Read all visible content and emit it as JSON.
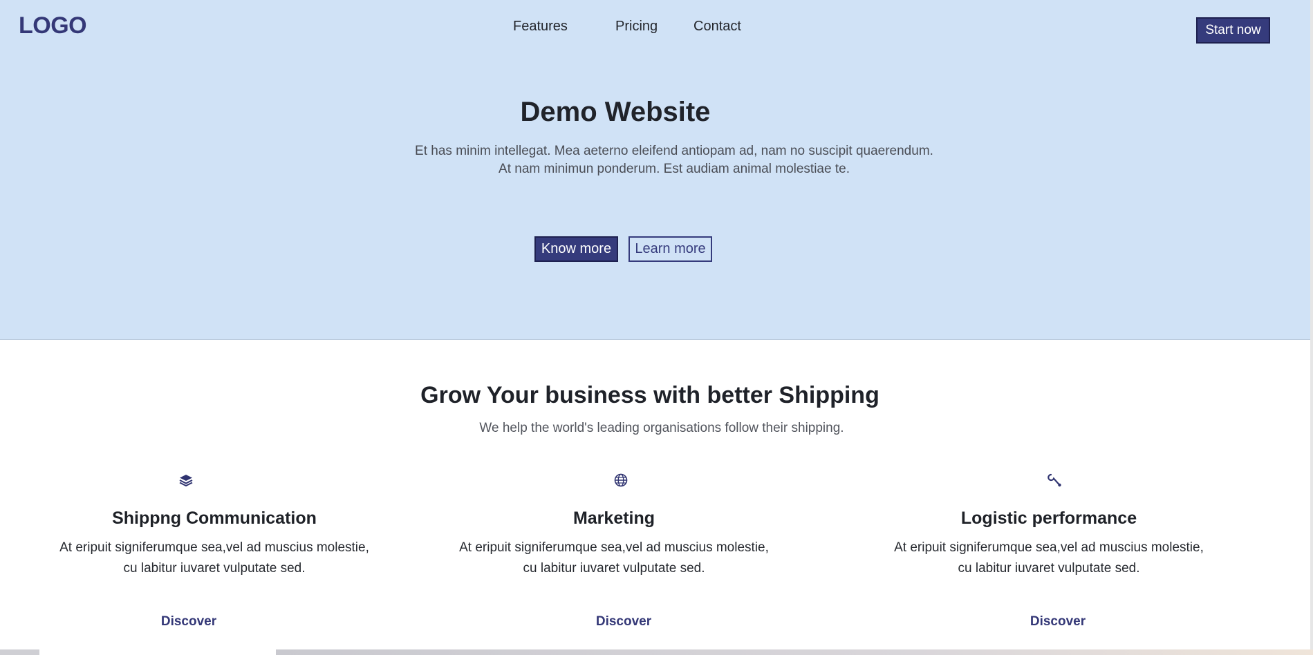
{
  "header": {
    "logo": "LOGO",
    "nav": [
      "Features",
      "Pricing",
      "Contact"
    ],
    "cta": "Start now"
  },
  "hero": {
    "title": "Demo Website",
    "subtitle_line1": "Et has minim intellegat. Mea aeterno eleifend antiopam ad, nam no suscipit quaerendum.",
    "subtitle_line2": "At nam minimun ponderum. Est audiam animal molestiae te.",
    "primary_button": "Know more",
    "secondary_button": "Learn more"
  },
  "section": {
    "title": "Grow Your business with better Shipping",
    "subtitle": "We help the world's leading organisations follow their shipping.",
    "features": [
      {
        "icon": "layers-icon",
        "title": "Shippng Communication",
        "text_line1": "At eripuit signiferumque sea,vel ad muscius molestie,",
        "text_line2": "cu labitur iuvaret vulputate sed.",
        "link": "Discover"
      },
      {
        "icon": "globe-icon",
        "title": "Marketing",
        "text_line1": "At eripuit signiferumque sea,vel ad muscius molestie,",
        "text_line2": "cu labitur iuvaret vulputate sed.",
        "link": "Discover"
      },
      {
        "icon": "wrench-icon",
        "title": "Logistic performance",
        "text_line1": "At eripuit signiferumque sea,vel ad muscius molestie,",
        "text_line2": "cu labitur iuvaret vulputate sed.",
        "link": "Discover"
      }
    ]
  },
  "colors": {
    "hero_bg": "#d0e2f6",
    "brand": "#353b7c",
    "text": "#1f2229"
  }
}
